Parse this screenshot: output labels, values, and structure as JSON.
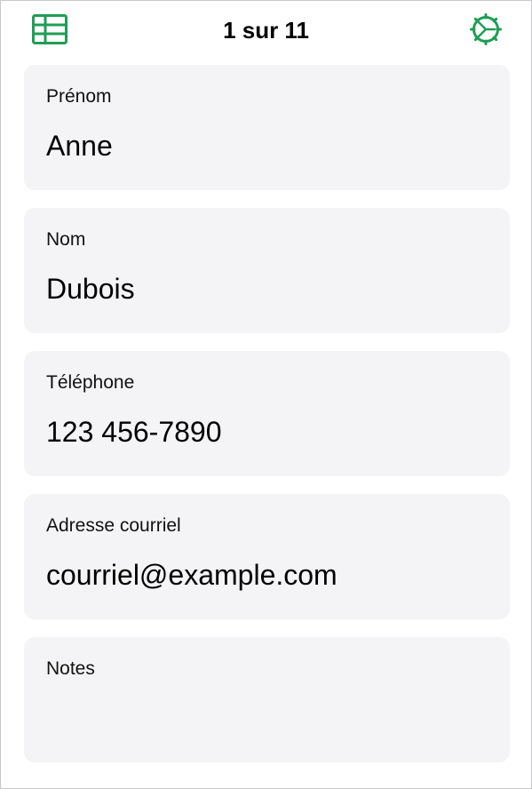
{
  "header": {
    "title": "1 sur 11",
    "left_icon": "table-view-icon",
    "right_icon": "settings-gear-icon",
    "accent_color": "#1f9d55"
  },
  "fields": [
    {
      "label": "Prénom",
      "value": "Anne"
    },
    {
      "label": "Nom",
      "value": "Dubois"
    },
    {
      "label": "Téléphone",
      "value": "123 456-7890"
    },
    {
      "label": "Adresse courriel",
      "value": "courriel@example.com"
    },
    {
      "label": "Notes",
      "value": ""
    }
  ]
}
